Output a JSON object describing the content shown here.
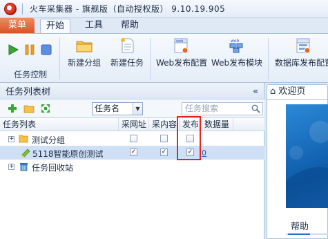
{
  "window": {
    "title": "火车采集器 - 旗舰版（自动授权版） 9.10.19.905"
  },
  "ribbon_tabs": [
    {
      "label": "菜单"
    },
    {
      "label": "开始"
    },
    {
      "label": "工具"
    },
    {
      "label": "帮助"
    }
  ],
  "ribbon": {
    "task_control_label": "任务控制",
    "new_group": "新建分组",
    "new_task": "新建任务",
    "web_publish_config": "Web发布配置",
    "web_publish_module": "Web发布模块",
    "db_publish_config": "数据库发布配置",
    "icon_web": "web"
  },
  "panel": {
    "title": "任务列表树",
    "collapse": "«",
    "combo_value": "任务名",
    "search_placeholder": "任务搜索"
  },
  "grid": {
    "columns": [
      "任务列表",
      "采网址",
      "采内容",
      "发布",
      "数据量"
    ],
    "rows": [
      {
        "label": "测试分组",
        "expander": "+",
        "url": false,
        "content": false,
        "publish": false,
        "count": ""
      },
      {
        "label": "5118智能原创测试",
        "expander": "",
        "url": true,
        "content": true,
        "publish": true,
        "count": "0"
      },
      {
        "label": "任务回收站",
        "expander": "+",
        "count": ""
      }
    ]
  },
  "right_pane": {
    "tab_label": "欢迎页",
    "help_label": "帮助"
  },
  "colors": {
    "accent": "#2a6fc9",
    "menu_tab": "#d9532a",
    "highlight": "#e8231c"
  }
}
